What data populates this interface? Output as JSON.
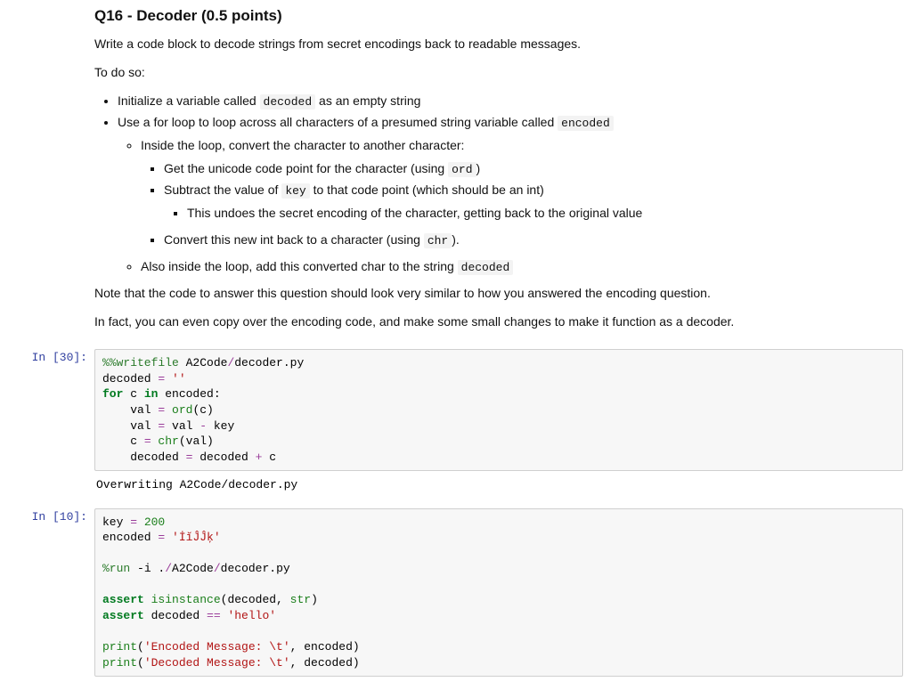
{
  "markdown": {
    "heading": "Q16 - Decoder (0.5 points)",
    "intro": "Write a code block to decode strings from secret encodings back to readable messages.",
    "todo": "To do so:",
    "b1a": "Initialize a variable called ",
    "b1_code": "decoded",
    "b1b": " as an empty string",
    "b2a": "Use a for loop to loop across all characters of a presumed string variable called ",
    "b2_code": "encoded",
    "b2s1": "Inside the loop, convert the character to another character:",
    "b2s1a_a": "Get the unicode code point for the character (using ",
    "b2s1a_code": "ord",
    "b2s1a_b": ")",
    "b2s1b_a": "Subtract the value of ",
    "b2s1b_code": "key",
    "b2s1b_b": " to that code point (which should be an int)",
    "b2s1b_sub": "This undoes the secret encoding of the character, getting back to the original value",
    "b2s1c_a": "Convert this new int back to a character (using ",
    "b2s1c_code": "chr",
    "b2s1c_b": ").",
    "b2s2a": "Also inside the loop, add this converted char to the string ",
    "b2s2_code": "decoded",
    "note": "Note that the code to answer this question should look very similar to how you answered the encoding question.",
    "hint": "In fact, you can even copy over the encoding code, and make some small changes to make it function as a decoder."
  },
  "cell1": {
    "prompt": "In [30]:",
    "l1_m": "%%writefile",
    "l1_r": " A2Code",
    "l1_op": "/",
    "l1_r2": "decoder.py",
    "l2_a": "decoded ",
    "l2_op": "=",
    "l2_str": " ''",
    "l3_for": "for",
    "l3_mid": " c ",
    "l3_in": "in",
    "l3_enc": " encoded:",
    "l4_a": "    val ",
    "l4_op": "=",
    "l4_fn": " ord",
    "l4_b": "(c)",
    "l5_a": "    val ",
    "l5_op1": "=",
    "l5_b": " val ",
    "l5_op2": "-",
    "l5_c": " key",
    "l6_a": "    c ",
    "l6_op": "=",
    "l6_fn": " chr",
    "l6_b": "(val)",
    "l7_a": "    decoded ",
    "l7_op1": "=",
    "l7_b": " decoded ",
    "l7_op2": "+",
    "l7_c": " c",
    "out": "Overwriting A2Code/decoder.py"
  },
  "cell2": {
    "prompt": "In [10]:",
    "l1_a": "key ",
    "l1_op": "=",
    "l1_num": " 200",
    "l2_a": "encoded ",
    "l2_op": "=",
    "l2_str": " 'İĭĴĴķ'",
    "blank1": "",
    "l3_m": "%run",
    "l3_r": " -i .",
    "l3_op": "/",
    "l3_r2": "A2Code",
    "l3_op2": "/",
    "l3_r3": "decoder.py",
    "blank2": "",
    "l4_kw": "assert",
    "l4_fn": " isinstance",
    "l4_b": "(decoded, ",
    "l4_ty": "str",
    "l4_c": ")",
    "l5_kw": "assert",
    "l5_b": " decoded ",
    "l5_op": "==",
    "l5_str": " 'hello'",
    "blank3": "",
    "l6_fn": "print",
    "l6_a": "(",
    "l6_str": "'Encoded Message: \\t'",
    "l6_b": ", encoded)",
    "l7_fn": "print",
    "l7_a": "(",
    "l7_str": "'Decoded Message: \\t'",
    "l7_b": ", decoded)"
  }
}
